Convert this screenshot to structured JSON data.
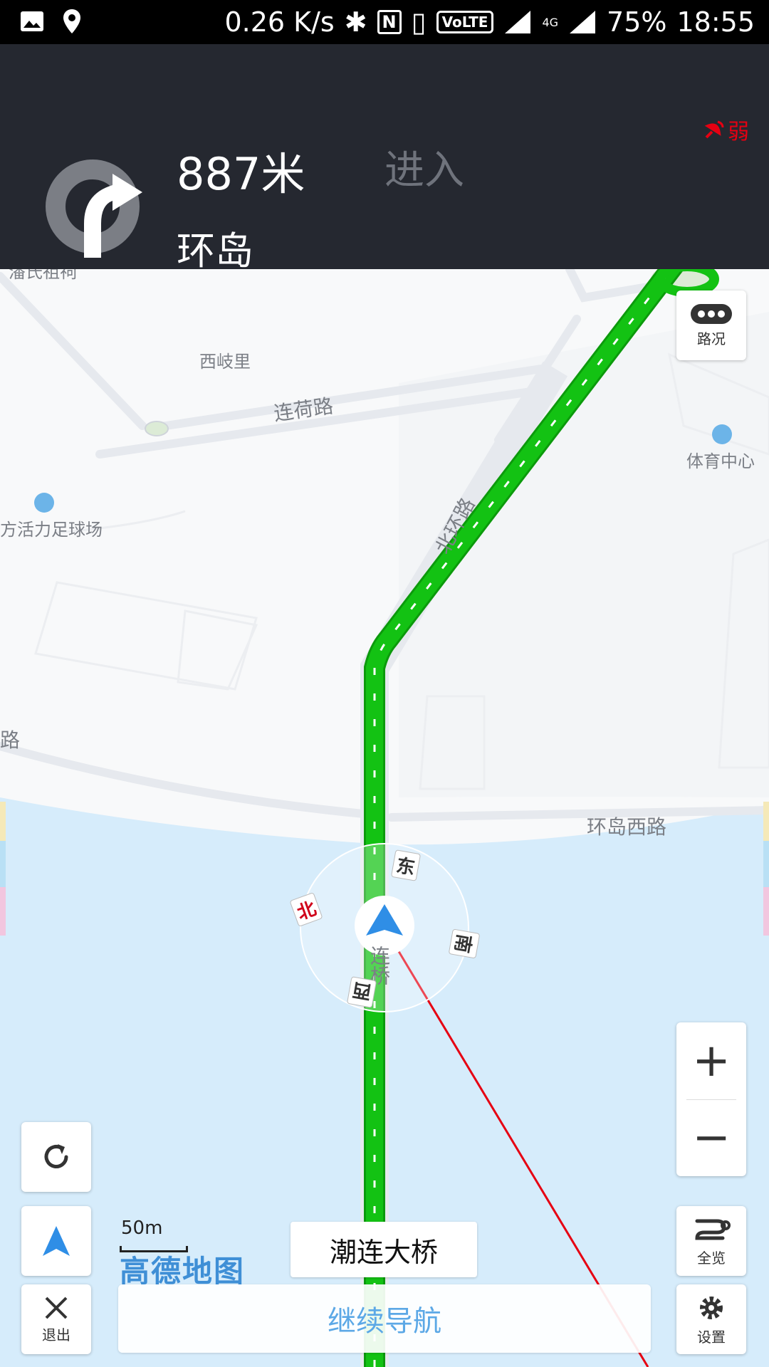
{
  "status_bar": {
    "net_speed": "0.26 K/s",
    "volte": "VoLTE",
    "network": "4G",
    "battery": "75%",
    "time": "18:55"
  },
  "nav": {
    "distance": "887米",
    "action": "进入",
    "road": "环岛",
    "signal": "弱"
  },
  "map": {
    "labels": {
      "pan_shi": "潘氏祖祠",
      "xi_qi_li": "西岐里",
      "lian_he_lu": "连荷路",
      "bei_huan_lu": "北环路",
      "sports_center": "体育中心",
      "football": "方活力足球场",
      "lu_left": "路",
      "huan_dao_xi_lu": "环岛西路",
      "lian_qiao": "连桥"
    },
    "compass": {
      "north": "北",
      "east": "东",
      "south": "南",
      "west": "西"
    }
  },
  "buttons": {
    "traffic": "路况",
    "zoom_in": "+",
    "zoom_out": "−",
    "overview": "全览",
    "settings": "设置",
    "exit": "退出"
  },
  "scale": "50m",
  "logo": "高德地图",
  "current_road": "潮连大桥",
  "continue_nav": "继续导航",
  "colors": {
    "route": "#13c213",
    "header_bg": "#252830",
    "water": "#d6ecfb",
    "alert_red": "#e60012",
    "accent_blue": "#3f8fd6"
  }
}
